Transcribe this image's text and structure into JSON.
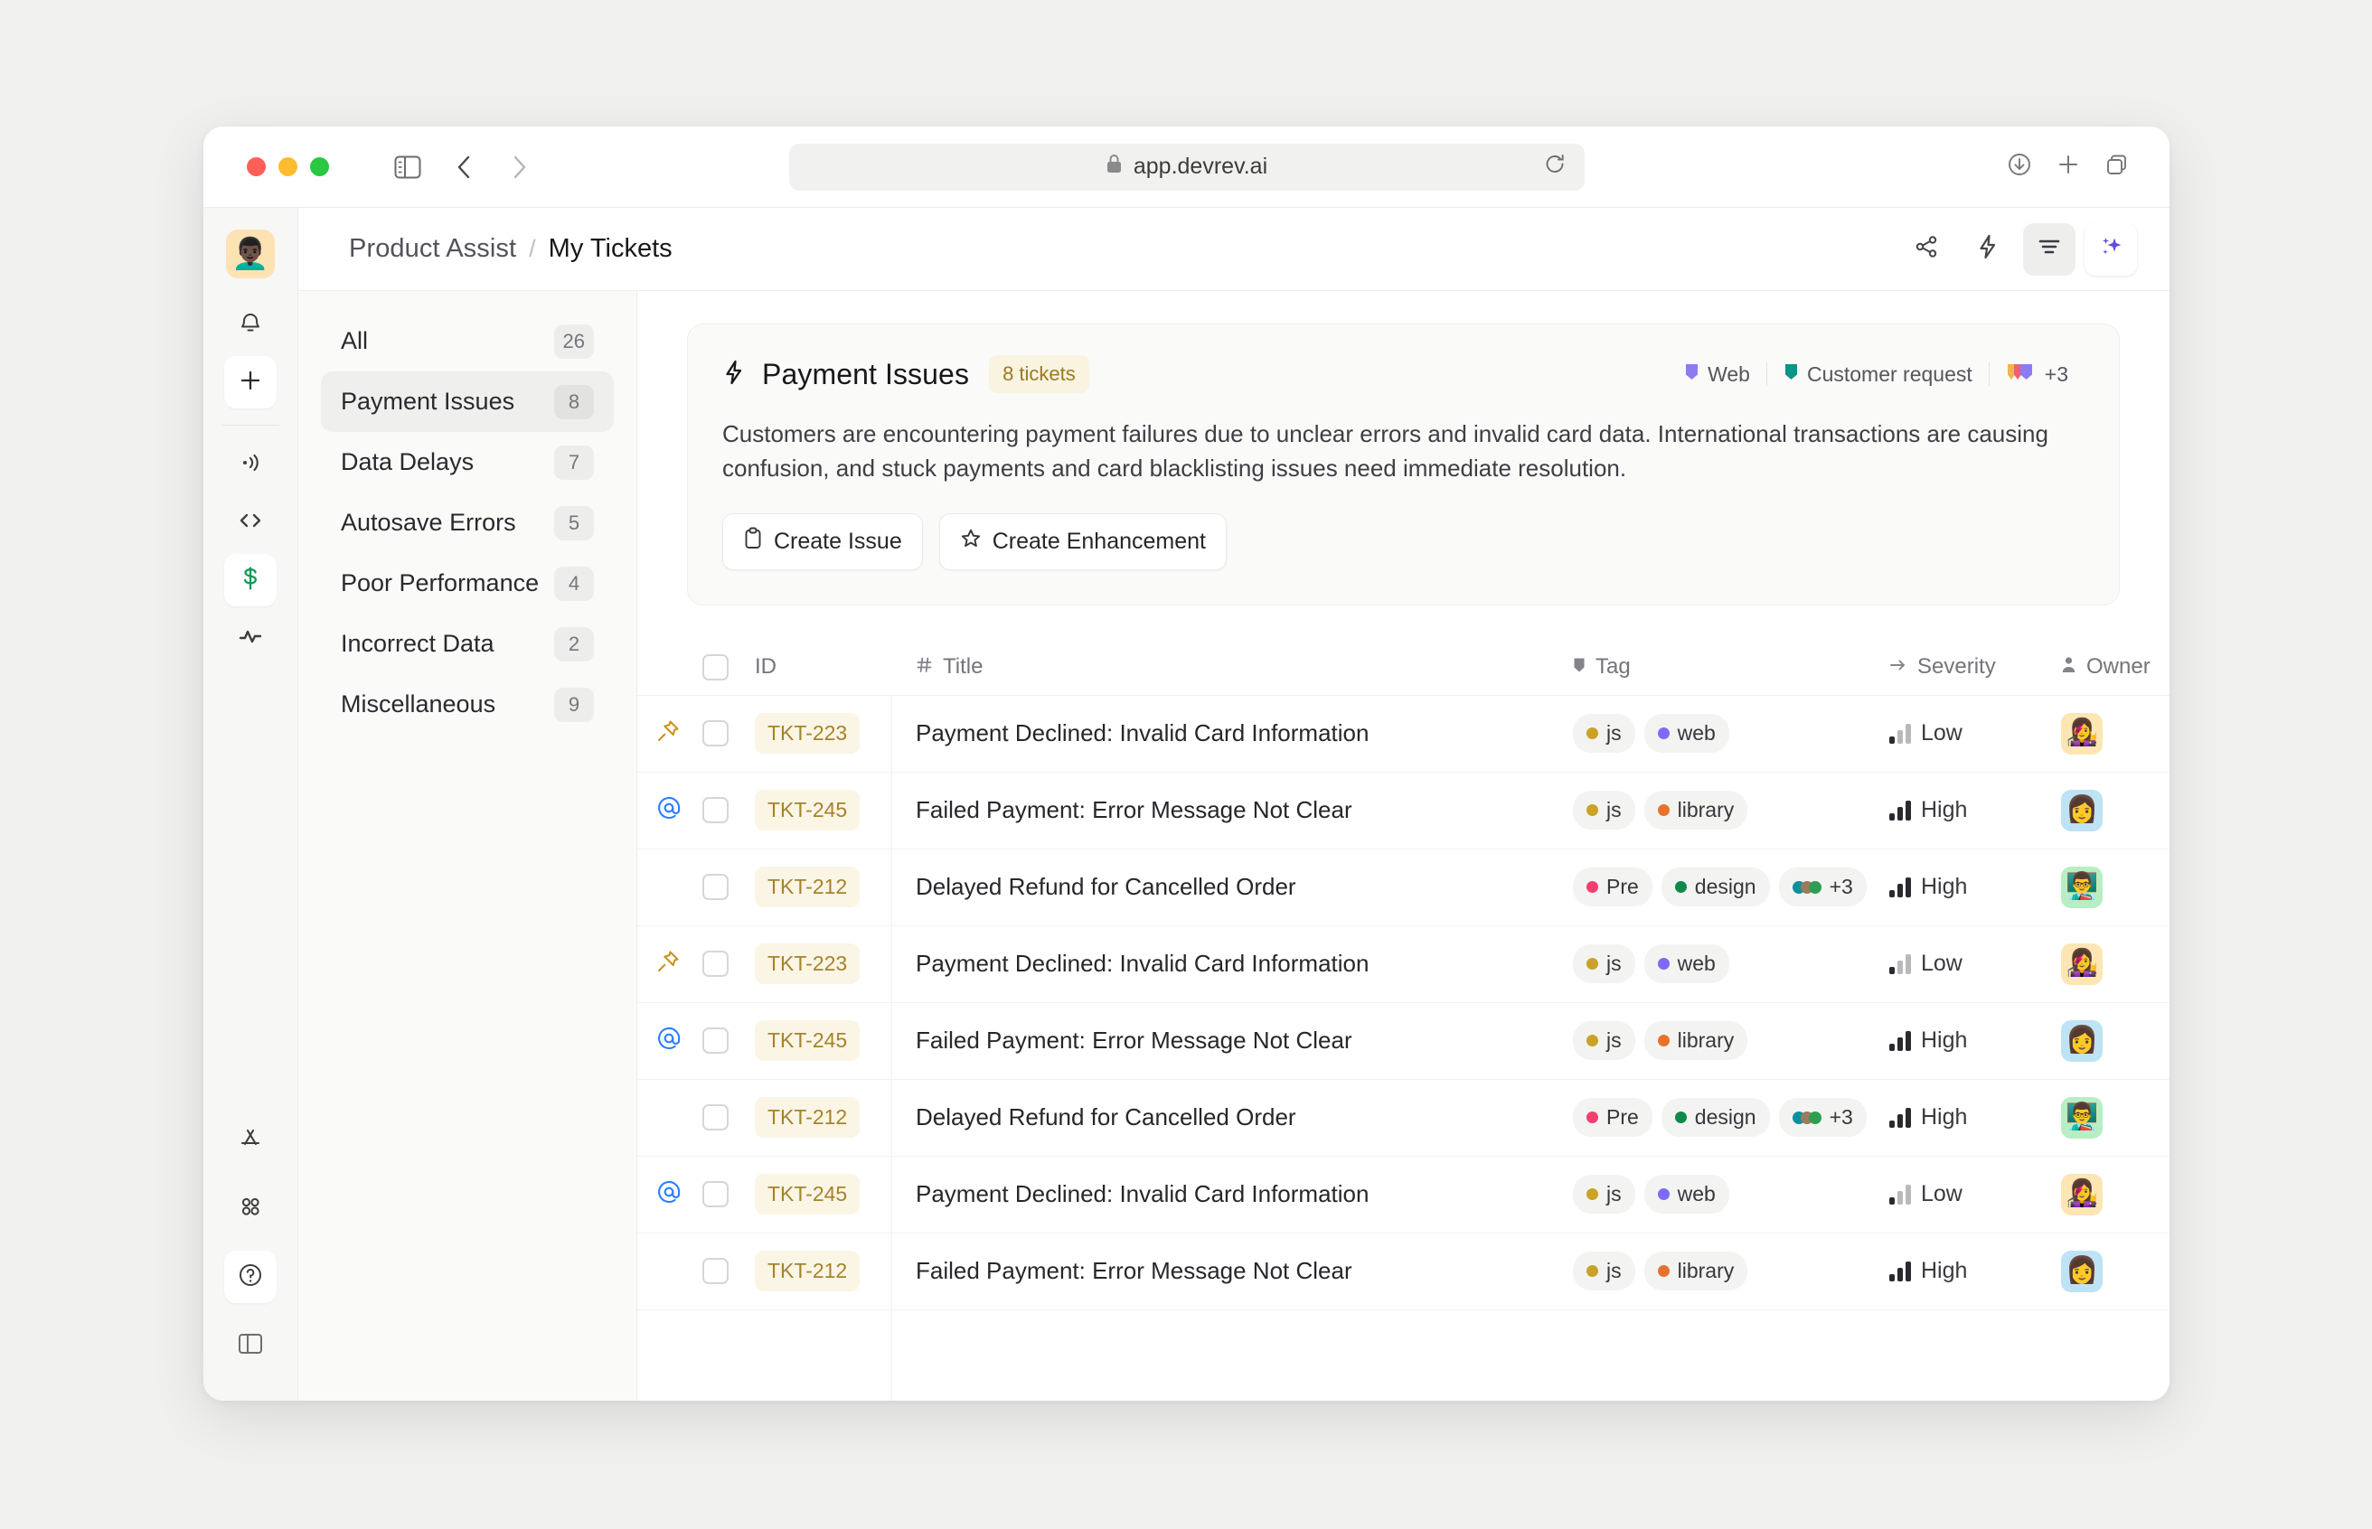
{
  "browser": {
    "url": "app.devrev.ai",
    "lock_icon": "lock-icon",
    "reload_icon": "reload-icon",
    "sidebar_toggle_icon": "sidebar-toggle-icon",
    "back_icon": "back-chevron-icon",
    "forward_icon": "forward-chevron-icon",
    "download_icon": "download-icon",
    "new_tab_icon": "plus-icon",
    "tabs_icon": "tab-overview-icon"
  },
  "rail": {
    "avatar_emoji": "👨🏿‍🦱",
    "items": [
      {
        "name": "notifications",
        "icon": "bell-icon",
        "active": false
      },
      {
        "name": "create",
        "icon": "plus-icon",
        "active": true
      },
      {
        "name": "broadcast",
        "icon": "broadcast-icon",
        "active": false
      },
      {
        "name": "code",
        "icon": "code-brackets-icon",
        "active": false
      },
      {
        "name": "billing",
        "icon": "dollar-icon",
        "active": true
      },
      {
        "name": "activity",
        "icon": "pulse-icon",
        "active": false
      }
    ],
    "bottom_items": [
      {
        "name": "apps",
        "icon": "app-store-icon",
        "active": false
      },
      {
        "name": "grid",
        "icon": "grid-circles-icon",
        "active": false
      },
      {
        "name": "help",
        "icon": "question-circle-icon",
        "active": true
      },
      {
        "name": "panel",
        "icon": "panel-toggle-icon",
        "active": false
      }
    ]
  },
  "header": {
    "breadcrumb_root": "Product Assist",
    "breadcrumb_sep": "/",
    "breadcrumb_current": "My Tickets",
    "actions": [
      {
        "name": "share",
        "icon": "share-icon"
      },
      {
        "name": "automation",
        "icon": "lightning-icon"
      },
      {
        "name": "filter",
        "icon": "filter-lines-icon"
      },
      {
        "name": "ai-assist",
        "icon": "sparkles-icon"
      }
    ]
  },
  "filters": {
    "items": [
      {
        "label": "All",
        "count": "26",
        "selected": false
      },
      {
        "label": "Payment Issues",
        "count": "8",
        "selected": true
      },
      {
        "label": "Data Delays",
        "count": "7",
        "selected": false
      },
      {
        "label": "Autosave Errors",
        "count": "5",
        "selected": false
      },
      {
        "label": "Poor Performance",
        "count": "4",
        "selected": false
      },
      {
        "label": "Incorrect Data",
        "count": "2",
        "selected": false
      },
      {
        "label": "Miscellaneous",
        "count": "9",
        "selected": false
      }
    ]
  },
  "card": {
    "icon": "lightning-icon",
    "title": "Payment Issues",
    "tickets_badge": "8 tickets",
    "chips": [
      {
        "label": "Web",
        "color": "#8b7cf0"
      },
      {
        "label": "Customer request",
        "color": "#0d9488"
      },
      {
        "label": "+3",
        "color": "#8b7cf0",
        "multi": true
      }
    ],
    "description": "Customers are encountering payment failures due to unclear errors and invalid card data. International transactions are causing confusion, and stuck payments and card blacklisting issues need immediate resolution.",
    "buttons": [
      {
        "label": "Create Issue",
        "icon": "clipboard-icon"
      },
      {
        "label": "Create Enhancement",
        "icon": "star-icon"
      }
    ]
  },
  "table": {
    "columns": [
      {
        "key": "id",
        "label": "ID",
        "icon": "checkbox-icon"
      },
      {
        "key": "title",
        "label": "Title",
        "icon": "hash-icon"
      },
      {
        "key": "tag",
        "label": "Tag",
        "icon": "tag-icon"
      },
      {
        "key": "severity",
        "label": "Severity",
        "icon": "arrow-right-icon"
      },
      {
        "key": "owner",
        "label": "Owner",
        "icon": "person-icon"
      }
    ],
    "rows": [
      {
        "flag": "pin",
        "id": "TKT-223",
        "title": "Payment Declined: Invalid Card Information",
        "tags": [
          {
            "label": "js",
            "color": "#c9a227"
          },
          {
            "label": "web",
            "color": "#7c6cf5"
          }
        ],
        "severity": "Low",
        "owner_emoji": "👩‍🎤",
        "owner_bg": "#fde6b3"
      },
      {
        "flag": "mention",
        "id": "TKT-245",
        "title": "Failed Payment: Error Message Not Clear",
        "tags": [
          {
            "label": "js",
            "color": "#c9a227"
          },
          {
            "label": "library",
            "color": "#e8722c"
          }
        ],
        "severity": "High",
        "owner_emoji": "👩",
        "owner_bg": "#bde3f5"
      },
      {
        "flag": "",
        "id": "TKT-212",
        "title": "Delayed Refund for Cancelled Order",
        "tags": [
          {
            "label": "Pre",
            "color": "#f43f6e"
          },
          {
            "label": "design",
            "color": "#0f8a4b"
          },
          {
            "label": "+3",
            "multi": true,
            "colors": [
              "#0e8f9e",
              "#9a7b5e",
              "#2f9e52"
            ]
          }
        ],
        "severity": "High",
        "owner_emoji": "👨‍🏫",
        "owner_bg": "#b8eec4"
      },
      {
        "flag": "pin",
        "id": "TKT-223",
        "title": "Payment Declined: Invalid Card Information",
        "tags": [
          {
            "label": "js",
            "color": "#c9a227"
          },
          {
            "label": "web",
            "color": "#7c6cf5"
          }
        ],
        "severity": "Low",
        "owner_emoji": "👩‍🎤",
        "owner_bg": "#fde6b3"
      },
      {
        "flag": "mention",
        "id": "TKT-245",
        "title": "Failed Payment: Error Message Not Clear",
        "tags": [
          {
            "label": "js",
            "color": "#c9a227"
          },
          {
            "label": "library",
            "color": "#e8722c"
          }
        ],
        "severity": "High",
        "owner_emoji": "👩",
        "owner_bg": "#bde3f5"
      },
      {
        "flag": "",
        "id": "TKT-212",
        "title": "Delayed Refund for Cancelled Order",
        "tags": [
          {
            "label": "Pre",
            "color": "#f43f6e"
          },
          {
            "label": "design",
            "color": "#0f8a4b"
          },
          {
            "label": "+3",
            "multi": true,
            "colors": [
              "#0e8f9e",
              "#9a7b5e",
              "#2f9e52"
            ]
          }
        ],
        "severity": "High",
        "owner_emoji": "👨‍🏫",
        "owner_bg": "#b8eec4"
      },
      {
        "flag": "mention",
        "id": "TKT-245",
        "title": "Payment Declined: Invalid Card Information",
        "tags": [
          {
            "label": "js",
            "color": "#c9a227"
          },
          {
            "label": "web",
            "color": "#7c6cf5"
          }
        ],
        "severity": "Low",
        "owner_emoji": "👩‍🎤",
        "owner_bg": "#fde6b3"
      },
      {
        "flag": "",
        "id": "TKT-212",
        "title": "Failed Payment: Error Message Not Clear",
        "tags": [
          {
            "label": "js",
            "color": "#c9a227"
          },
          {
            "label": "library",
            "color": "#e8722c"
          }
        ],
        "severity": "High",
        "owner_emoji": "👩",
        "owner_bg": "#bde3f5"
      }
    ]
  },
  "colors": {
    "accent_purple": "#5b4fdb",
    "id_pill_bg": "#faf5e5",
    "id_pill_text": "#a5832c",
    "pin": "#c9931f",
    "mention": "#2b7fff"
  }
}
